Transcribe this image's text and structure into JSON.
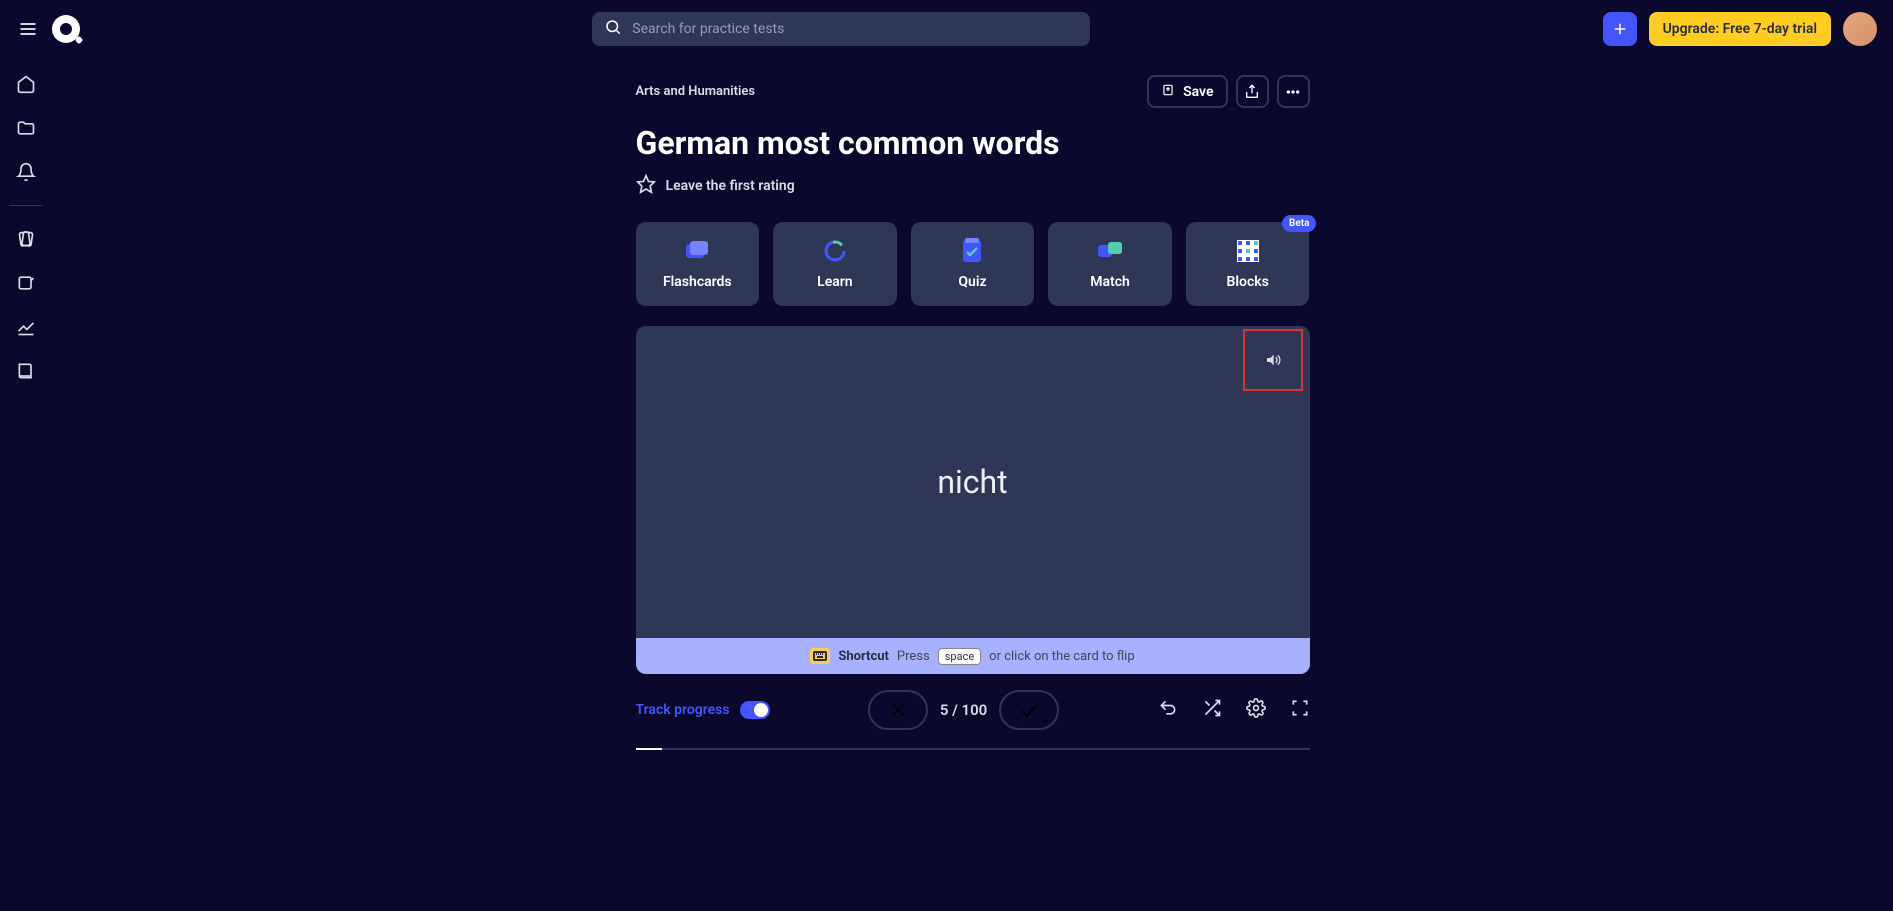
{
  "header": {
    "search_placeholder": "Search for practice tests",
    "upgrade_label": "Upgrade: Free 7-day trial"
  },
  "breadcrumb": "Arts and Humanities",
  "page_title": "German most common words",
  "rating_text": "Leave the first rating",
  "save_label": "Save",
  "modes": {
    "flashcards": "Flashcards",
    "learn": "Learn",
    "quiz": "Quiz",
    "match": "Match",
    "blocks": "Blocks",
    "beta": "Beta"
  },
  "flashcard": {
    "word": "nicht",
    "shortcut": "Shortcut",
    "press": "Press",
    "space": "space",
    "rest": "or click on the card to flip"
  },
  "controls": {
    "track": "Track progress",
    "counter": "5 / 100"
  }
}
